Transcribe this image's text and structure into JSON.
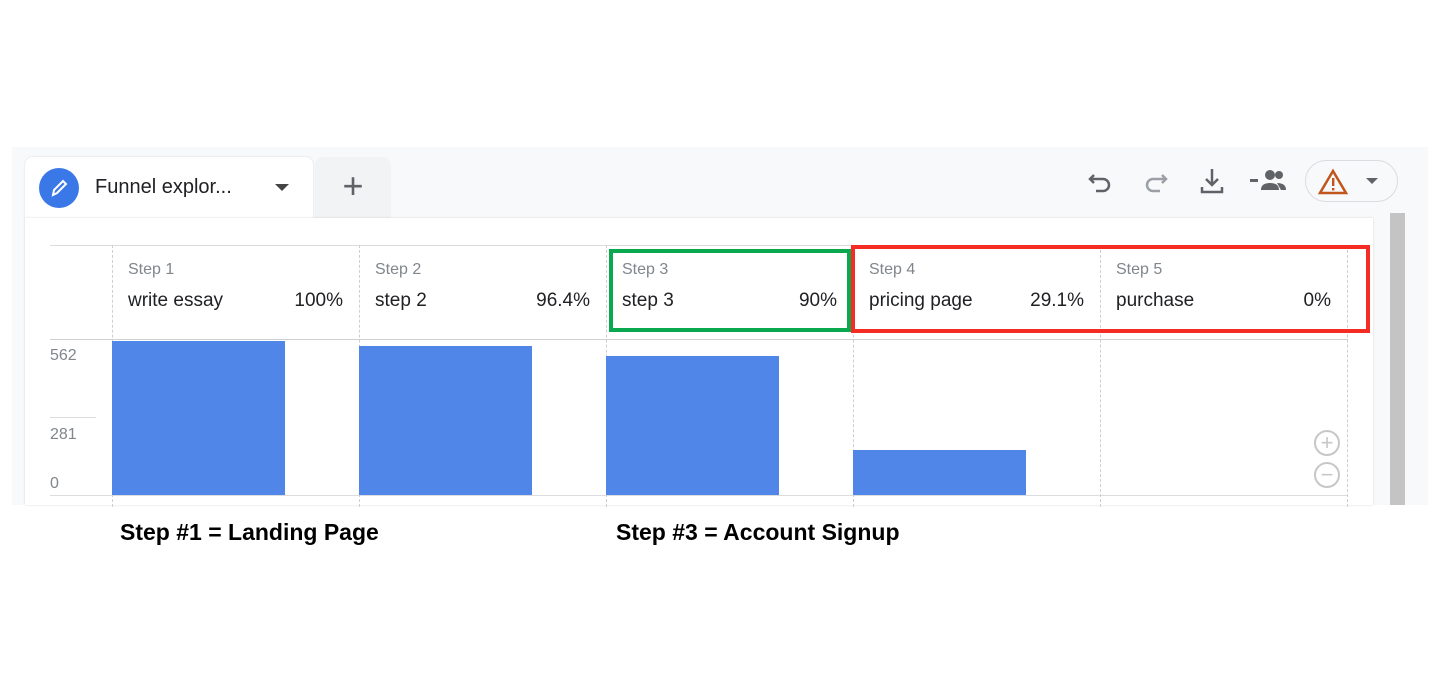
{
  "tab": {
    "title": "Funnel explor...",
    "icon": "pencil-icon",
    "add_label": "+"
  },
  "toolbar": {
    "icons": [
      "undo-icon",
      "redo-icon",
      "download-icon",
      "share-users-icon",
      "warning-icon"
    ]
  },
  "chart_data": {
    "type": "bar",
    "categories": [
      "write essay",
      "step 2",
      "step 3",
      "pricing page",
      "purchase"
    ],
    "step_labels": [
      "Step 1",
      "Step 2",
      "Step 3",
      "Step 4",
      "Step 5"
    ],
    "percents": [
      "100%",
      "96.4%",
      "90%",
      "29.1%",
      "0%"
    ],
    "values": [
      555,
      535,
      500,
      162,
      0
    ],
    "yticks": [
      "562",
      "281",
      "0"
    ],
    "ylim": [
      0,
      562
    ],
    "color": "#4f86e8"
  },
  "highlights": {
    "green": "#0aa84f",
    "red": "#f52c23"
  },
  "notes": {
    "left": "Step #1 = Landing Page",
    "right": "Step #3 = Account Signup"
  }
}
